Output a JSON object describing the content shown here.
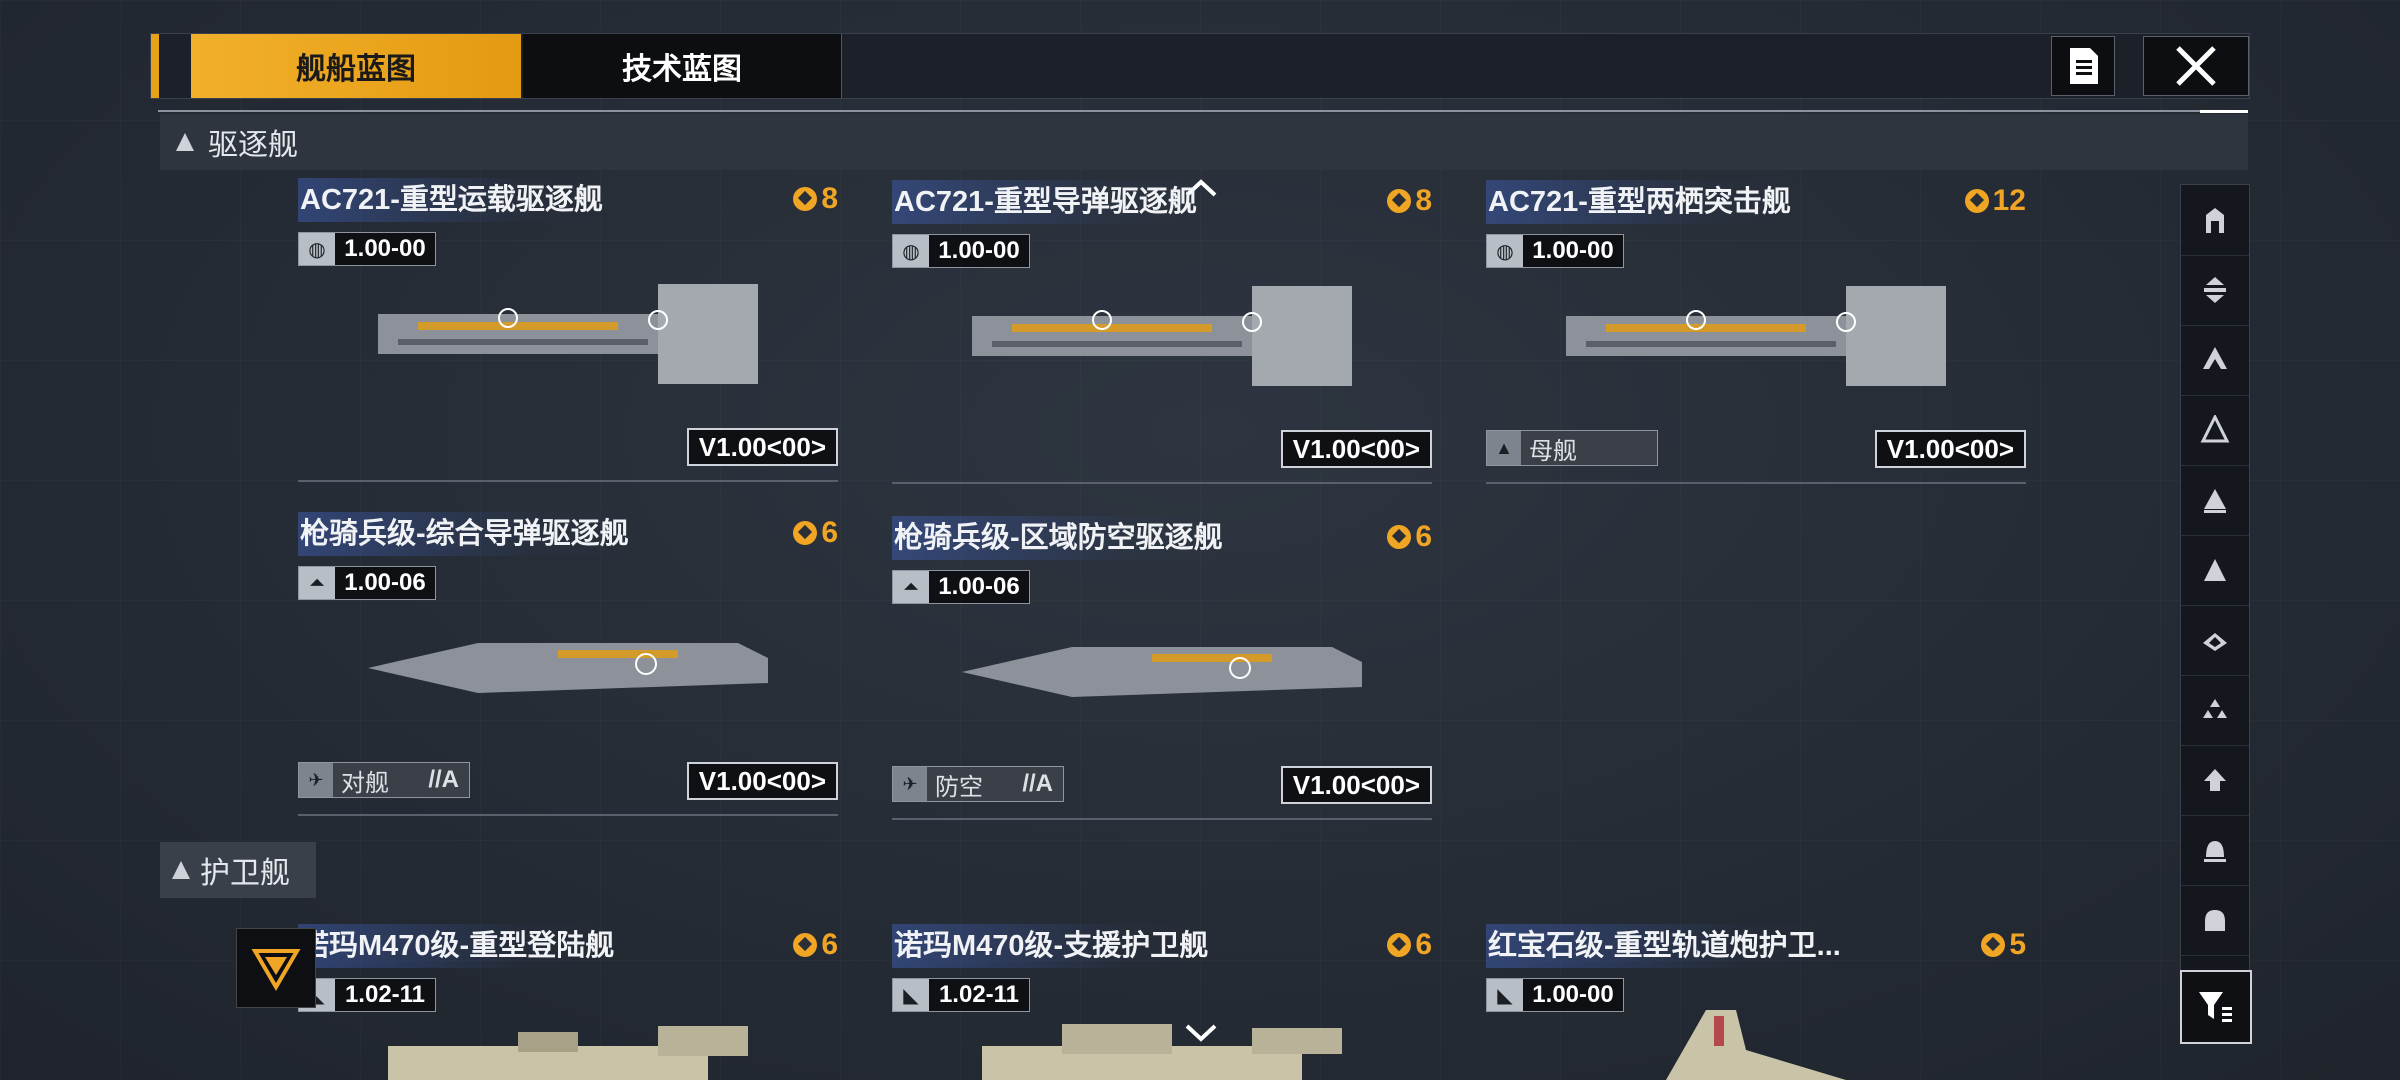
{
  "tabs": {
    "ship_blueprint": "舰船蓝图",
    "tech_blueprint": "技术蓝图"
  },
  "sections": {
    "destroyer": "驱逐舰",
    "frigate": "护卫舰"
  },
  "destroyers": [
    {
      "title": "AC721-重型运载驱逐舰",
      "cost": "8",
      "version": "1.00-00",
      "ver_icon": "globe-icon",
      "vtag": "V1.00<00>",
      "ship": "destroyer-ac721"
    },
    {
      "title": "AC721-重型导弹驱逐舰",
      "cost": "8",
      "version": "1.00-00",
      "ver_icon": "globe-icon",
      "vtag": "V1.00<00>",
      "ship": "destroyer-ac721"
    },
    {
      "title": "AC721-重型两栖突击舰",
      "cost": "12",
      "version": "1.00-00",
      "ver_icon": "globe-icon",
      "vtag": "V1.00<00>",
      "role": "母舰",
      "role_icon": "carrier-icon",
      "ship": "destroyer-ac721"
    },
    {
      "title": "枪骑兵级-综合导弹驱逐舰",
      "cost": "6",
      "version": "1.00-06",
      "ver_icon": "lancer-icon",
      "vtag": "V1.00<00>",
      "role": "对舰",
      "role_sub": "//A",
      "role_icon": "anti-ship-icon",
      "ship": "destroyer-lancer"
    },
    {
      "title": "枪骑兵级-区域防空驱逐舰",
      "cost": "6",
      "version": "1.00-06",
      "ver_icon": "lancer-icon",
      "vtag": "V1.00<00>",
      "role": "防空",
      "role_sub": "//A",
      "role_icon": "anti-air-icon",
      "ship": "destroyer-lancer"
    }
  ],
  "frigates": [
    {
      "title": "诺玛M470级-重型登陆舰",
      "cost": "6",
      "version": "1.02-11",
      "ver_icon": "nomad-icon"
    },
    {
      "title": "诺玛M470级-支援护卫舰",
      "cost": "6",
      "version": "1.02-11",
      "ver_icon": "nomad-icon"
    },
    {
      "title": "红宝石级-重型轨道炮护卫...",
      "cost": "5",
      "version": "1.00-00",
      "ver_icon": "nomad-icon"
    }
  ],
  "sidebar_icons": [
    "carrier-class-icon",
    "battlecruiser-class-icon",
    "cruiser-class-icon",
    "destroyer-outline-icon",
    "destroyer-class-icon",
    "frigate-class-icon",
    "corvette-class-icon",
    "fighter-class-icon",
    "support-class-icon",
    "auxiliary-class-icon",
    "utility-class-icon"
  ],
  "colors": {
    "accent": "#e9a319",
    "cost": "#f0a524",
    "panel": "#1c2129"
  }
}
